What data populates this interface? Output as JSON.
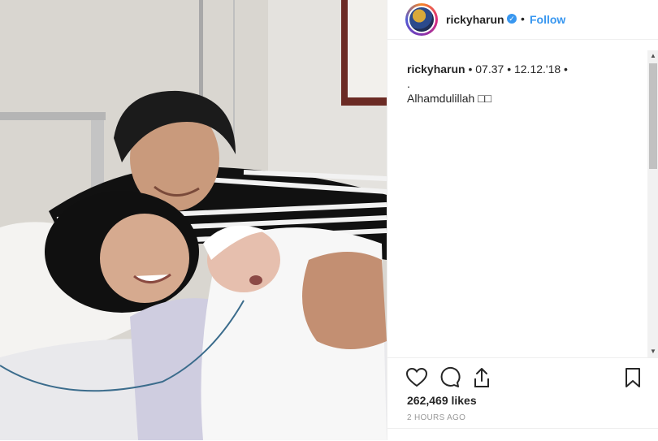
{
  "header": {
    "username": "ricky​harun",
    "separator": "•",
    "follow_label": "Follow",
    "verified_icon": "verified-badge-icon"
  },
  "caption": {
    "username": "rickyharun",
    "meta": " • 07.37 • 12.12.'18 •",
    "dot_line": ".",
    "text": "Alhamdulillah □□"
  },
  "actions": {
    "like_icon": "heart-icon",
    "comment_icon": "comment-icon",
    "share_icon": "share-icon",
    "save_icon": "bookmark-icon"
  },
  "likes": "262,469 likes",
  "time": "2 HOURS AGO",
  "colors": {
    "accent": "#3897f0",
    "text": "#262626",
    "muted": "#999999",
    "border": "#efefef"
  }
}
